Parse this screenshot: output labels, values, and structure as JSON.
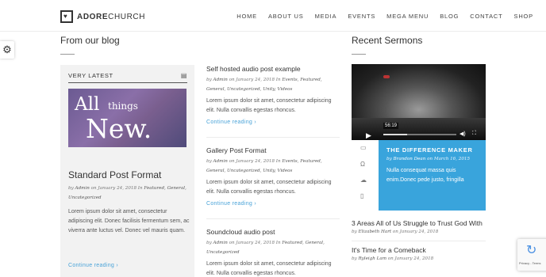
{
  "header": {
    "logo_bold": "ADORE",
    "logo_light": "CHURCH",
    "nav": [
      "HOME",
      "ABOUT US",
      "MEDIA",
      "EVENTS",
      "MEGA MENU",
      "BLOG",
      "CONTACT",
      "SHOP"
    ]
  },
  "settings_icon": "gears-icon",
  "blog": {
    "section_title": "From our blog",
    "latest_label": "VERY LATEST",
    "featured": {
      "image_text": [
        "All",
        "things",
        "New."
      ],
      "title": "Standard Post Format",
      "meta_prefix": "by",
      "author": "Admin",
      "date_text": "on January 24, 2018 In",
      "categories": "Featured, General, Uncategorized",
      "excerpt": "Lorem ipsum dolor sit amet, consectetur adipiscing elit. Donec facilisis fermentum sem, ac viverra ante luctus vel. Donec vel mauris quam.",
      "continue": "Continue reading ›"
    },
    "posts": [
      {
        "title": "Self hosted audio post example",
        "author": "Admin",
        "date_text": "on January 24, 2018 In",
        "categories": "Events, Featured, General, Uncategorized, Unity, Videos",
        "excerpt": "Lorem ipsum dolor sit amet, consectetur adipiscing elit. Nulla convallis egestas rhoncus.",
        "continue": "Continue reading ›"
      },
      {
        "title": "Gallery Post Format",
        "author": "Admin",
        "date_text": "on January 24, 2018 In",
        "categories": "Events, Featured, General, Uncategorized, Unity, Videos",
        "excerpt": "Lorem ipsum dolor sit amet, consectetur adipiscing elit. Nulla convallis egestas rhoncus.",
        "continue": "Continue reading ›"
      },
      {
        "title": "Soundcloud audio post",
        "author": "Admin",
        "date_text": "on January 24, 2018 In",
        "categories": "Featured, General, Uncategorized",
        "excerpt": "Lorem ipsum dolor sit amet, consectetur adipiscing elit. Nulla convallis egestas rhoncus."
      }
    ]
  },
  "sermons": {
    "section_title": "Recent Sermons",
    "video": {
      "time": "56:19",
      "progress": 0.33
    },
    "featured": {
      "title": "THE DIFFERENCE MAKER",
      "by": "by",
      "author": "Brandon Dean",
      "date": "on March 16, 2015",
      "body": "Nulla consequat massa quis enim.Donec pede justo, fringilla"
    },
    "icons": [
      "folder-icon",
      "headphones-icon",
      "download-icon",
      "book-icon"
    ],
    "list": [
      {
        "title": "3 Areas All of Us Struggle to Trust God With",
        "by": "by",
        "author": "Elizabeth Hart",
        "date": "on January 24, 2018"
      },
      {
        "title": "It's Time for a Comeback",
        "by": "by",
        "author": "Ryleigh Lam",
        "date": "on January 24, 2018"
      }
    ]
  },
  "recaptcha": {
    "text": "Privacy - Terms"
  }
}
